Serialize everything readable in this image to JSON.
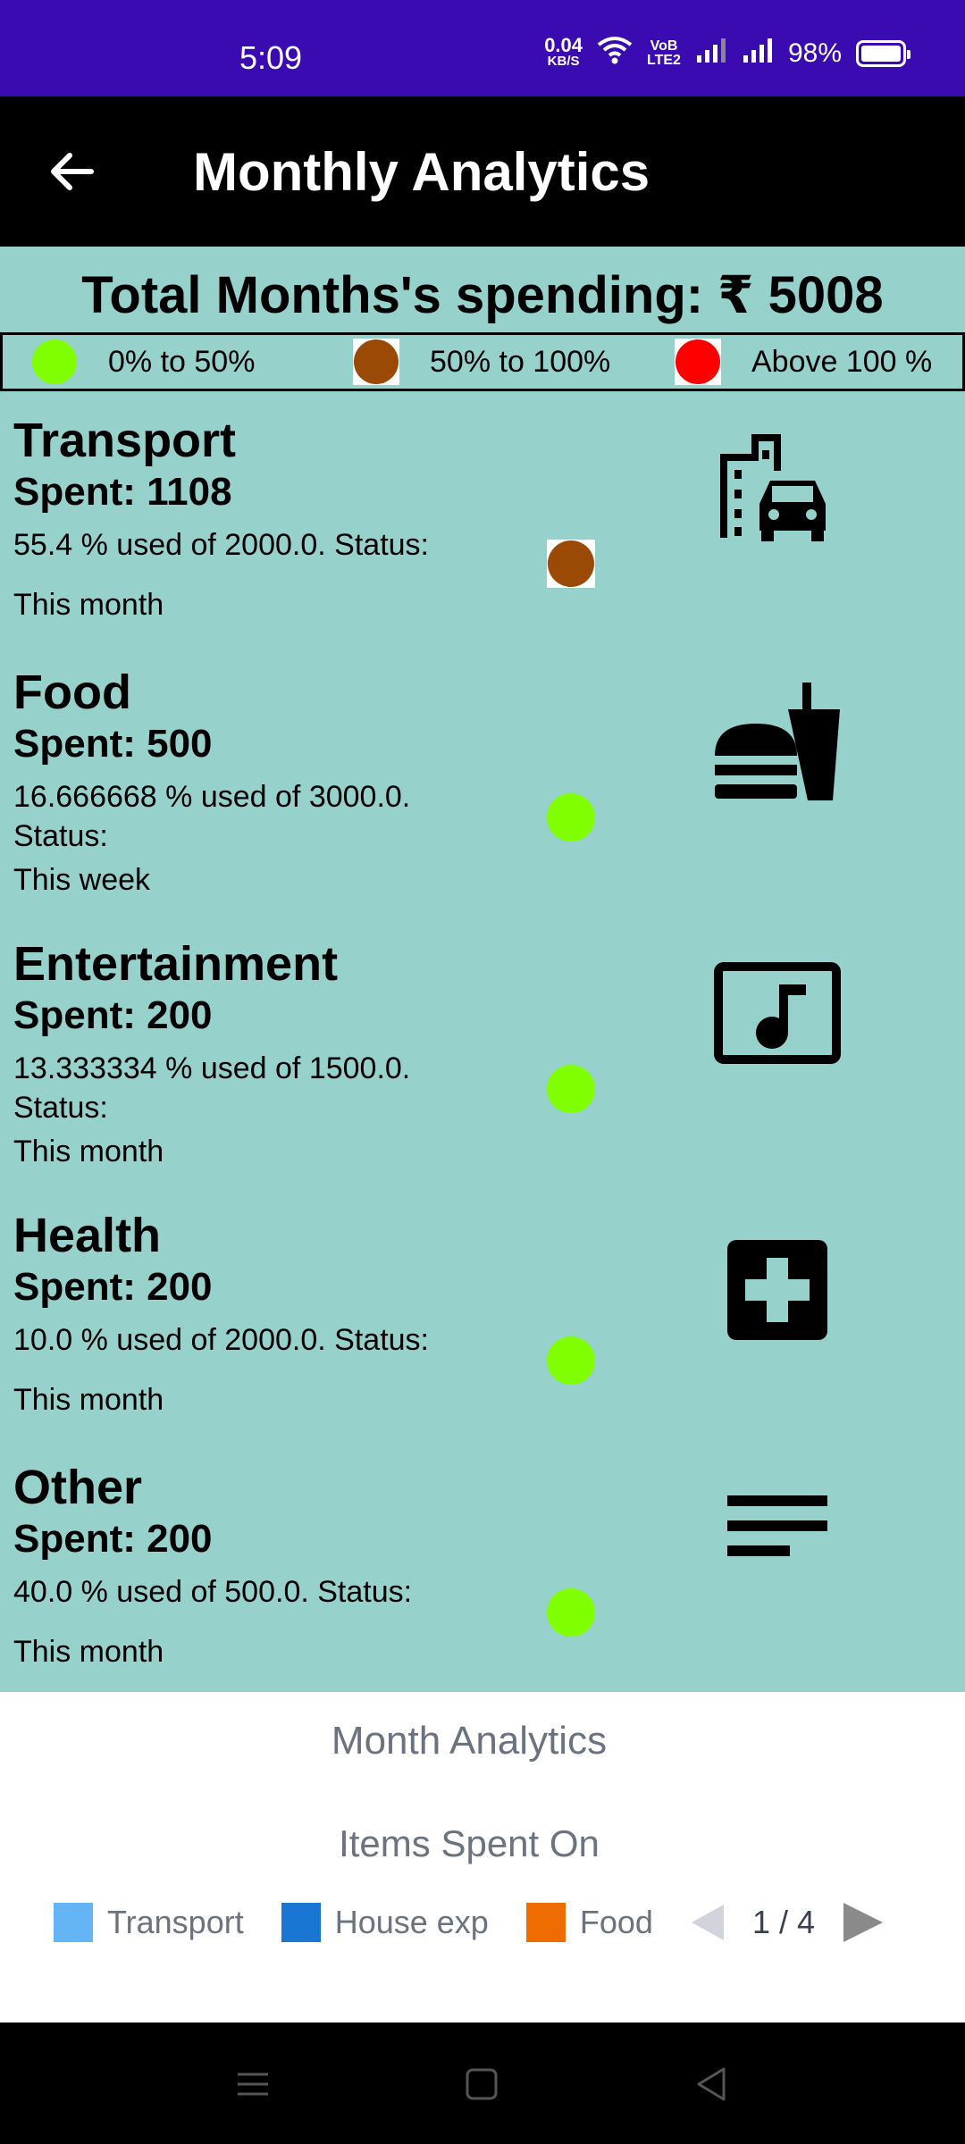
{
  "status_bar": {
    "time": "5:09",
    "net_speed": "0.04",
    "net_unit": "KB/S",
    "volte_top": "VoB",
    "volte_bottom": "LTE2",
    "battery": "98%"
  },
  "app_bar": {
    "title": "Monthly Analytics"
  },
  "summary": {
    "total": "Total Months's spending: ₹ 5008"
  },
  "legend": [
    {
      "label": "0% to 50%",
      "color": "#80ff00"
    },
    {
      "label": "50% to 100%",
      "color": "#9a4a04"
    },
    {
      "label": "Above 100 %",
      "color": "#ff0000"
    }
  ],
  "categories": [
    {
      "name": "Transport",
      "spent": "Spent: 1108",
      "desc": "55.4 % used of 2000.0. Status:",
      "period": "This month",
      "status_color": "#9a4a04",
      "icon": "transport-icon"
    },
    {
      "name": "Food",
      "spent": "Spent: 500",
      "desc": "16.666668 % used of 3000.0. Status:",
      "period": "This week",
      "status_color": "#80ff00",
      "icon": "fastfood-icon"
    },
    {
      "name": "Entertainment",
      "spent": "Spent: 200",
      "desc": "13.333334 % used of 1500.0. Status:",
      "period": "This month",
      "status_color": "#80ff00",
      "icon": "music-note-icon"
    },
    {
      "name": "Health",
      "spent": "Spent: 200",
      "desc": "10.0 % used of 2000.0. Status:",
      "period": "This month",
      "status_color": "#80ff00",
      "icon": "medical-cross-icon"
    },
    {
      "name": "Other",
      "spent": "Spent: 200",
      "desc": "40.0 % used of 500.0. Status:",
      "period": "This month",
      "status_color": "#80ff00",
      "icon": "notes-icon"
    }
  ],
  "chart": {
    "title": "Month Analytics",
    "subtitle": "Items Spent On",
    "legend": [
      {
        "label": "Transport",
        "color": "#64b5f6"
      },
      {
        "label": "House exp",
        "color": "#1976d2"
      },
      {
        "label": "Food",
        "color": "#ef6c00"
      }
    ],
    "page": "1 / 4"
  }
}
